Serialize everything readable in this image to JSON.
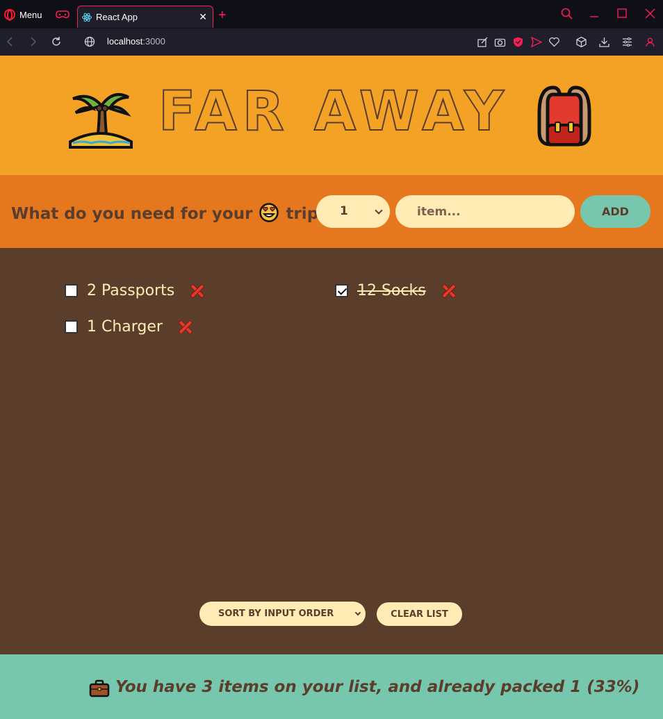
{
  "browser": {
    "menu_label": "Menu",
    "tab_title": "React App",
    "url_host": "localhost",
    "url_port": ":3000"
  },
  "app": {
    "title": "FAR AWAY",
    "form": {
      "question_before": "What do you need for your",
      "question_after": "trip?",
      "quantity_value": "1",
      "item_placeholder": "item...",
      "add_label": "ADD"
    },
    "items": [
      {
        "label": "2 Passports",
        "packed": false
      },
      {
        "label": "12 Socks",
        "packed": true
      },
      {
        "label": "1 Charger",
        "packed": false
      }
    ],
    "actions": {
      "sort_value": "SORT BY INPUT ORDER",
      "clear_label": "CLEAR LIST"
    },
    "stats": {
      "text": "You have 3 items on your list, and already packed 1 (33%)"
    }
  },
  "colors": {
    "header_bg": "#f4a226",
    "form_bg": "#e5771f",
    "list_bg": "#5a3e2b",
    "stats_bg": "#76c7ad",
    "cream": "#ffebb3",
    "accent_red": "#ff1b55"
  }
}
